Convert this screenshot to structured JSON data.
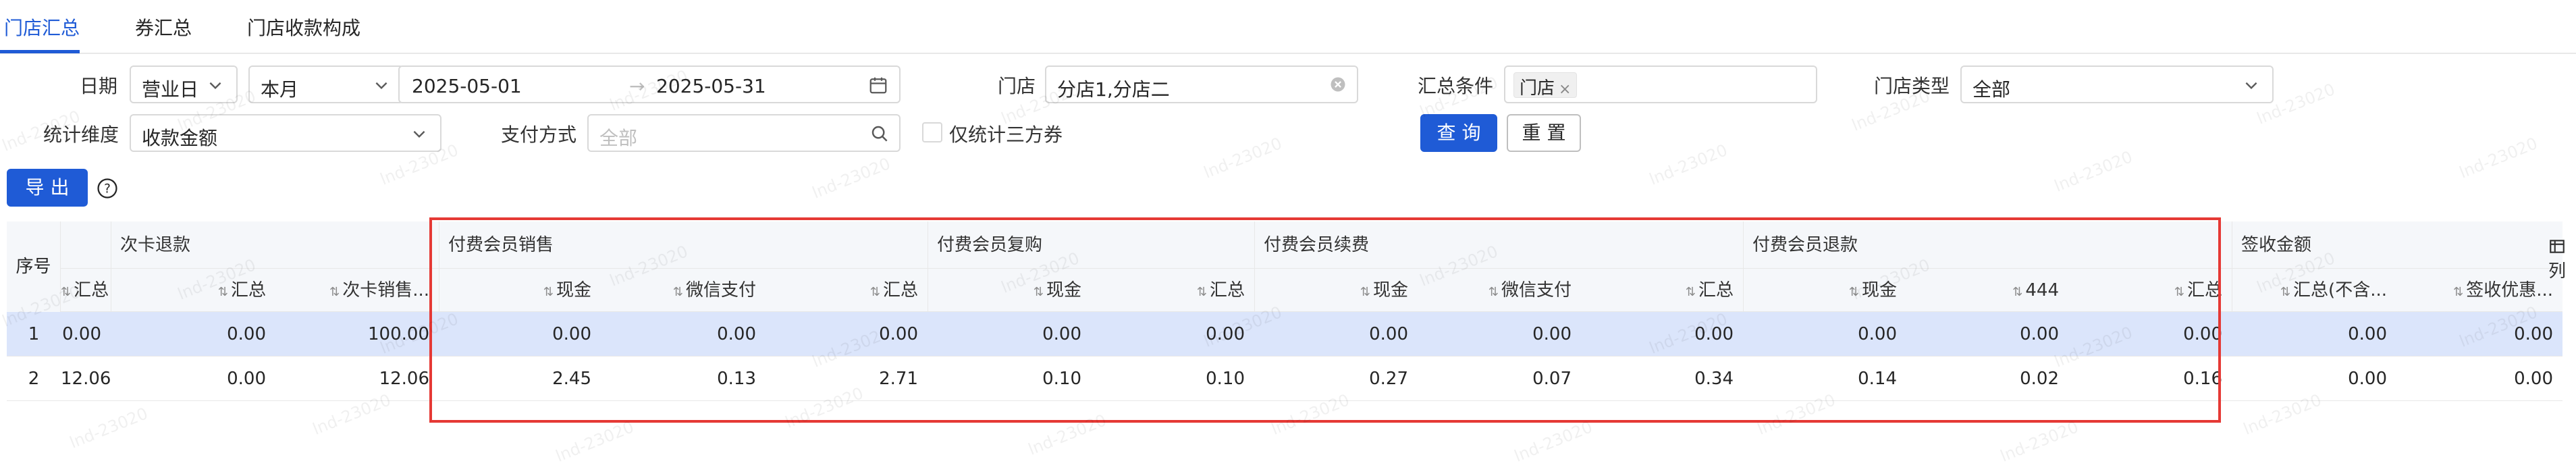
{
  "tabs": [
    {
      "label": "门店汇总",
      "active": true
    },
    {
      "label": "券汇总",
      "active": false
    },
    {
      "label": "门店收款构成",
      "active": false
    }
  ],
  "filters": {
    "date_label": "日期",
    "date_type": "营业日",
    "period": "本月",
    "date_start": "2025-05-01",
    "date_arrow": "→",
    "date_end": "2025-05-31",
    "store_label": "门店",
    "store_value": "分店1,分店二",
    "summary_label": "汇总条件",
    "summary_tag": "门店",
    "summary_tag_close": "×",
    "store_type_label": "门店类型",
    "store_type_value": "全部",
    "dimension_label": "统计维度",
    "dimension_value": "收款金额",
    "payment_label": "支付方式",
    "payment_placeholder": "全部",
    "third_party_label": "仅统计三方券"
  },
  "actions": {
    "query": "查 询",
    "reset": "重 置",
    "export": "导 出",
    "help_icon": "?"
  },
  "table": {
    "seq_header": "序号",
    "group_headers": [
      "次卡退款",
      "付费会员销售",
      "付费会员复购",
      "付费会员续费",
      "付费会员退款",
      "签收金额"
    ],
    "col_headers": [
      "汇总",
      "汇总",
      "次卡销售...",
      "现金",
      "微信支付",
      "汇总",
      "现金",
      "汇总",
      "现金",
      "微信支付",
      "汇总",
      "现金",
      "444",
      "汇总",
      "汇总(不含...",
      "签收优惠..."
    ],
    "rows": [
      {
        "seq": "1",
        "cells": [
          "0.00",
          "0.00",
          "100.00",
          "0.00",
          "0.00",
          "0.00",
          "0.00",
          "0.00",
          "0.00",
          "0.00",
          "0.00",
          "0.00",
          "0.00",
          "0.00",
          "0.00",
          "0.00"
        ]
      },
      {
        "seq": "2",
        "cells": [
          "12.06",
          "0.00",
          "12.06",
          "2.45",
          "0.13",
          "2.71",
          "0.10",
          "0.10",
          "0.27",
          "0.07",
          "0.34",
          "0.14",
          "0.02",
          "0.16",
          "0.00",
          "0.00"
        ]
      }
    ],
    "column_settings": "列"
  },
  "watermark": "lnd-23020",
  "colors": {
    "primary": "#1f5bd6",
    "highlight_border": "#e53935",
    "selected_row": "#dbe5fb"
  }
}
